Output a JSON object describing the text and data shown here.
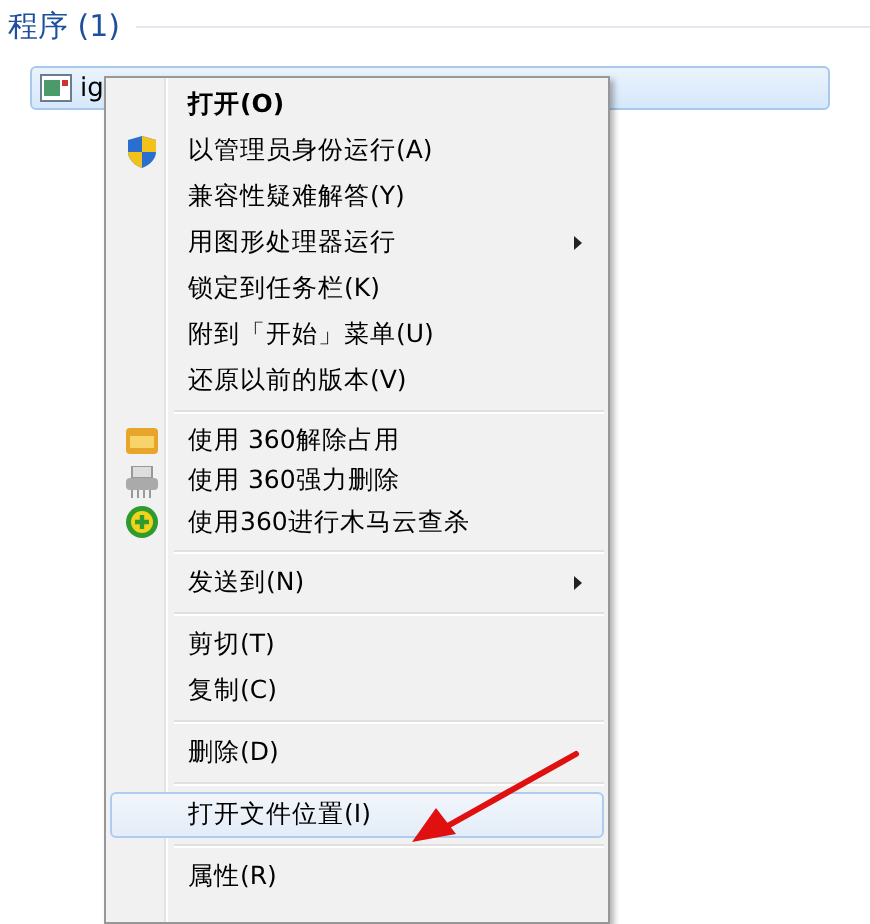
{
  "section": {
    "title": "程序 (1)"
  },
  "result": {
    "label": "ig",
    "selected": true
  },
  "menu": [
    {
      "kind": "item",
      "label": "打开(O)",
      "bold": true,
      "submenu": false,
      "selected": false
    },
    {
      "kind": "admin",
      "label": "以管理员身份运行(A)",
      "bold": false,
      "submenu": false,
      "selected": false
    },
    {
      "kind": "item",
      "label": "兼容性疑难解答(Y)",
      "bold": false,
      "submenu": false,
      "selected": false
    },
    {
      "kind": "item",
      "label": "用图形处理器运行",
      "bold": false,
      "submenu": true,
      "selected": false
    },
    {
      "kind": "item",
      "label": "锁定到任务栏(K)",
      "bold": false,
      "submenu": false,
      "selected": false
    },
    {
      "kind": "item",
      "label": "附到「开始」菜单(U)",
      "bold": false,
      "submenu": false,
      "selected": false
    },
    {
      "kind": "item",
      "label": "还原以前的版本(V)",
      "bold": false,
      "submenu": false,
      "selected": false
    },
    {
      "kind": "separator"
    },
    {
      "kind": "unlock",
      "label": "使用 360解除占用",
      "bold": false,
      "submenu": false,
      "selected": false
    },
    {
      "kind": "shred",
      "label": "使用 360强力删除",
      "bold": false,
      "submenu": false,
      "selected": false
    },
    {
      "kind": "scan",
      "label": "使用360进行木马云查杀",
      "bold": false,
      "submenu": false,
      "selected": false
    },
    {
      "kind": "separator"
    },
    {
      "kind": "item",
      "label": "发送到(N)",
      "bold": false,
      "submenu": true,
      "selected": false
    },
    {
      "kind": "separator"
    },
    {
      "kind": "item",
      "label": "剪切(T)",
      "bold": false,
      "submenu": false,
      "selected": false
    },
    {
      "kind": "item",
      "label": "复制(C)",
      "bold": false,
      "submenu": false,
      "selected": false
    },
    {
      "kind": "separator"
    },
    {
      "kind": "item",
      "label": "删除(D)",
      "bold": false,
      "submenu": false,
      "selected": false
    },
    {
      "kind": "separator"
    },
    {
      "kind": "item",
      "label": "打开文件位置(I)",
      "bold": false,
      "submenu": false,
      "selected": true
    },
    {
      "kind": "separator"
    },
    {
      "kind": "item",
      "label": "属性(R)",
      "bold": false,
      "submenu": false,
      "selected": false
    }
  ]
}
